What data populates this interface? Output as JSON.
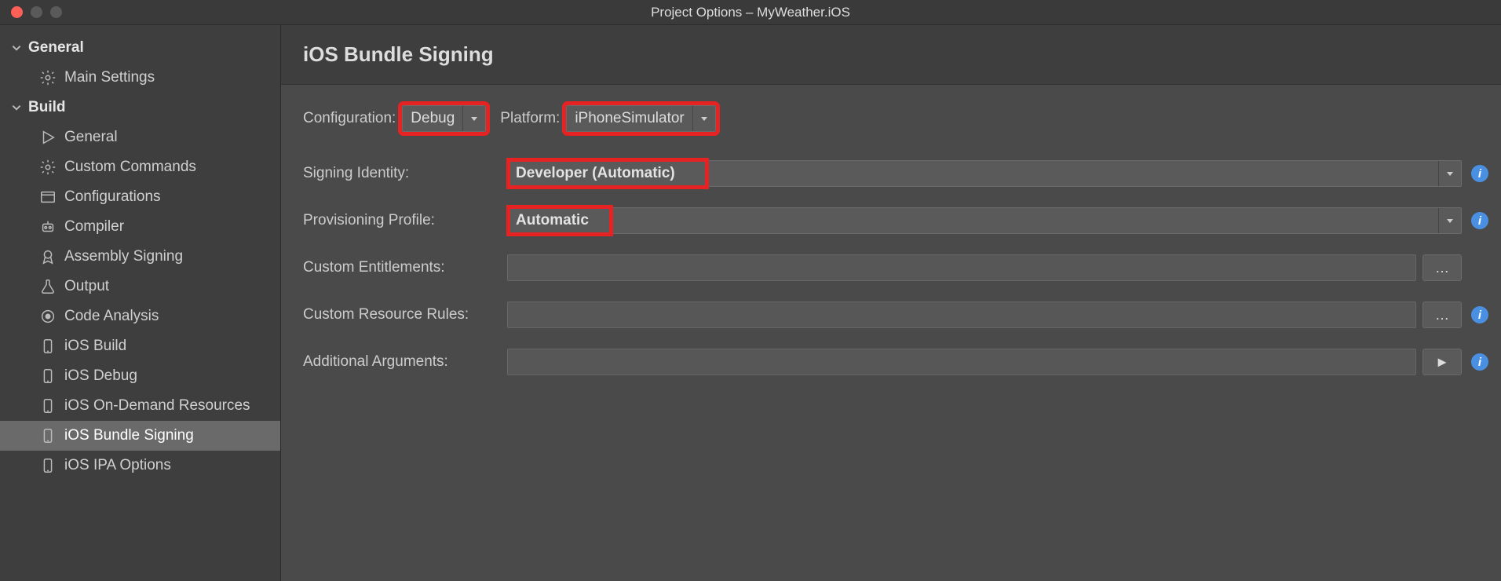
{
  "window": {
    "title": "Project Options – MyWeather.iOS"
  },
  "sidebar": {
    "sections": [
      {
        "label": "General",
        "items": [
          {
            "label": "Main Settings",
            "icon": "gear-icon"
          }
        ]
      },
      {
        "label": "Build",
        "items": [
          {
            "label": "General",
            "icon": "play-icon"
          },
          {
            "label": "Custom Commands",
            "icon": "gear-icon"
          },
          {
            "label": "Configurations",
            "icon": "window-icon"
          },
          {
            "label": "Compiler",
            "icon": "robot-icon"
          },
          {
            "label": "Assembly Signing",
            "icon": "badge-icon"
          },
          {
            "label": "Output",
            "icon": "flask-icon"
          },
          {
            "label": "Code Analysis",
            "icon": "target-icon"
          },
          {
            "label": "iOS Build",
            "icon": "device-icon"
          },
          {
            "label": "iOS Debug",
            "icon": "device-icon"
          },
          {
            "label": "iOS On-Demand Resources",
            "icon": "device-icon"
          },
          {
            "label": "iOS Bundle Signing",
            "icon": "device-icon",
            "selected": true
          },
          {
            "label": "iOS IPA Options",
            "icon": "device-icon"
          }
        ]
      }
    ]
  },
  "main": {
    "title": "iOS Bundle Signing",
    "config": {
      "configuration_label": "Configuration:",
      "configuration_value": "Debug",
      "platform_label": "Platform:",
      "platform_value": "iPhoneSimulator"
    },
    "fields": {
      "signing_identity": {
        "label": "Signing Identity:",
        "value": "Developer (Automatic)"
      },
      "provisioning_profile": {
        "label": "Provisioning Profile:",
        "value": "Automatic"
      },
      "custom_entitlements": {
        "label": "Custom Entitlements:",
        "value": "",
        "browse": "…"
      },
      "custom_resource_rules": {
        "label": "Custom Resource Rules:",
        "value": "",
        "browse": "…"
      },
      "additional_arguments": {
        "label": "Additional Arguments:",
        "value": "",
        "browse": "►"
      }
    }
  }
}
